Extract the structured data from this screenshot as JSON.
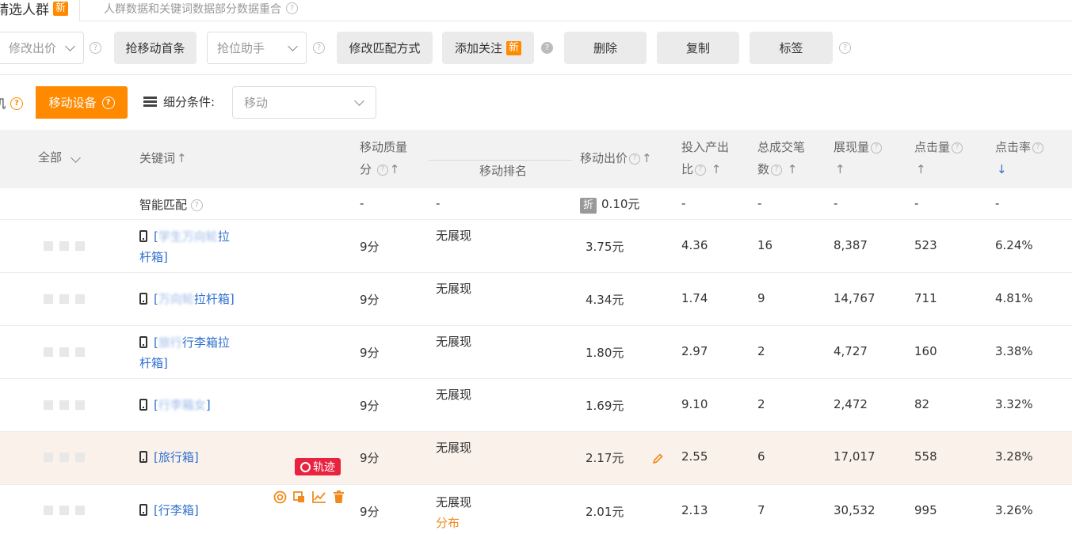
{
  "tabs": {
    "active_label": "精选人群",
    "active_badge": "新",
    "other_label": "人群数据和关键词数据部分数据重合"
  },
  "toolbar": {
    "modify_bid": "修改出价",
    "grab_top": "抢移动首条",
    "grab_assist": "抢位助手",
    "modify_match": "修改匹配方式",
    "add_follow": "添加关注",
    "add_follow_badge": "新",
    "delete": "删除",
    "copy": "复制",
    "tag": "标签"
  },
  "filter": {
    "prev_label": "机",
    "active_label": "移动设备",
    "subdivide_label": "细分条件:",
    "subdivide_value": "移动"
  },
  "table": {
    "headers": {
      "all": "全部",
      "keyword": "关键词",
      "quality_1": "移动质量",
      "quality_2": "分",
      "rank": "移动排名",
      "bid": "移动出价",
      "roi_1": "投入产出",
      "roi_2": "比",
      "trades_1": "总成交笔",
      "trades_2": "数",
      "impressions": "展现量",
      "clicks": "点击量",
      "ctr": "点击率",
      "up_arrow": "↑",
      "down_arrow": "↓"
    },
    "smart_row": {
      "keyword": "智能匹配",
      "quality": "-",
      "rank": "-",
      "discount_badge": "折",
      "bid": "0.10元",
      "roi": "-",
      "trades": "-",
      "impressions": "-",
      "clicks": "-",
      "ctr": "-"
    },
    "rows": [
      {
        "kw_line1_pre": "[",
        "kw_line1_blur": "学生万向轮",
        "kw_line1_post": "拉",
        "kw_line2": "杆箱]",
        "quality": "9分",
        "rank": "无展现",
        "bid": "3.75元",
        "roi": "4.36",
        "trades": "16",
        "impressions": "8,387",
        "clicks": "523",
        "ctr": "6.24%"
      },
      {
        "kw_line1_pre": "[",
        "kw_line1_blur": "万向轮",
        "kw_line1_post": "拉杆箱]",
        "kw_line2": "",
        "quality": "9分",
        "rank": "无展现",
        "bid": "4.34元",
        "roi": "1.74",
        "trades": "9",
        "impressions": "14,767",
        "clicks": "711",
        "ctr": "4.81%"
      },
      {
        "kw_line1_pre": "[",
        "kw_line1_blur": "旅行",
        "kw_line1_post": "行李箱拉",
        "kw_line2": "杆箱]",
        "quality": "9分",
        "rank": "无展现",
        "bid": "1.80元",
        "roi": "2.97",
        "trades": "2",
        "impressions": "4,727",
        "clicks": "160",
        "ctr": "3.38%"
      },
      {
        "kw_line1_pre": "[",
        "kw_line1_blur": "行李箱女",
        "kw_line1_post": "]",
        "kw_line2": "",
        "quality": "9分",
        "rank": "无展现",
        "bid": "1.69元",
        "roi": "9.10",
        "trades": "2",
        "impressions": "2,472",
        "clicks": "82",
        "ctr": "3.32%"
      },
      {
        "kw_line1_pre": "[旅行箱]",
        "kw_line1_blur": "",
        "kw_line1_post": "",
        "kw_line2": "",
        "quality": "9分",
        "rank": "无展现",
        "bid": "2.17元",
        "roi": "2.55",
        "trades": "6",
        "impressions": "17,017",
        "clicks": "558",
        "ctr": "3.28%",
        "track_label": "轨迹"
      },
      {
        "kw_line1_pre": "[行李箱]",
        "kw_line1_blur": "",
        "kw_line1_post": "",
        "kw_line2": "",
        "quality": "9分",
        "rank": "无展现",
        "rank_link": "分布",
        "bid": "2.01元",
        "roi": "2.13",
        "trades": "7",
        "impressions": "30,532",
        "clicks": "995",
        "ctr": "3.26%"
      }
    ]
  },
  "icons": {
    "help": "question-circle-icon",
    "phone": "mobile-phone-icon",
    "edit": "pencil-icon",
    "trash": "trash-icon",
    "chart": "line-chart-icon",
    "target": "target-icon"
  },
  "colors": {
    "accent": "#ff8a00",
    "link": "#2f6fce",
    "track": "#e8223f",
    "row_highlight": "#faf2ea"
  }
}
